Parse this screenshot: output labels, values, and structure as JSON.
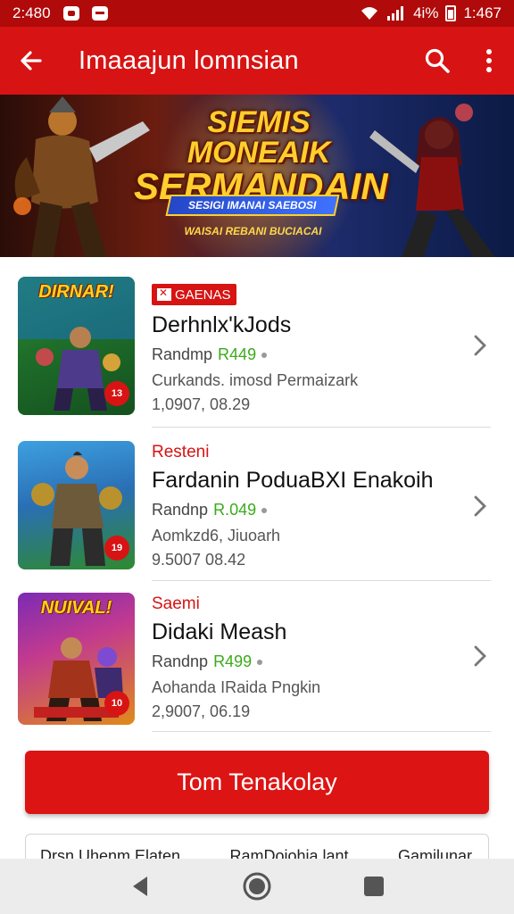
{
  "status_bar": {
    "time_left": "2:480",
    "battery": "4i%",
    "time_right": "1:467"
  },
  "app_bar": {
    "title": "Imaaajun lomnsian",
    "icons": [
      "back-arrow-icon",
      "search-icon",
      "more-vert-icon"
    ]
  },
  "banner": {
    "title_line1": "SIEMIS MONEAIK",
    "title_line2": "SERMANDAIN",
    "ribbon": "SESIGI IMANAI SAEBOSI",
    "tagline": "WAISAI REBANI BUCIACAI"
  },
  "items": [
    {
      "thumb_label": "DIRNAR!",
      "thumb_badge": "13",
      "tag": "GAENAS",
      "tag_boxed": true,
      "title": "Derhnlx'kJods",
      "price_label": "Randmp",
      "price_value": "R449",
      "subtitle": "Curkands. imosd Permaizark",
      "date": "1,0907, 08.29"
    },
    {
      "thumb_label": "",
      "thumb_badge": "19",
      "tag": "Resteni",
      "tag_boxed": false,
      "title": "Fardanin PoduaBXI Enakoih",
      "price_label": "Randnp",
      "price_value": "R.049",
      "subtitle": "Aomkzd6, Jiuoarh",
      "date": "9.5007 08.42"
    },
    {
      "thumb_label": "NUIVAL!",
      "thumb_badge": "10",
      "tag": "Saemi",
      "tag_boxed": false,
      "title": "Didaki Meash",
      "price_label": "Randnp",
      "price_value": "R499",
      "subtitle": "Aohanda IRaida Pngkin",
      "date": "2,9007, 06.19"
    }
  ],
  "cta": {
    "label": "Tom Tenakolay"
  },
  "bottom_tabs": [
    "Drsn Uhenm Elaten",
    "RamDoiohia lant",
    "Gamilunar"
  ],
  "colors": {
    "primary_red": "#d81313",
    "status_red": "#b00a0a",
    "price_green": "#3caa1a"
  },
  "nav_bar": [
    "back-triangle-icon",
    "home-circle-icon",
    "recents-square-icon"
  ]
}
